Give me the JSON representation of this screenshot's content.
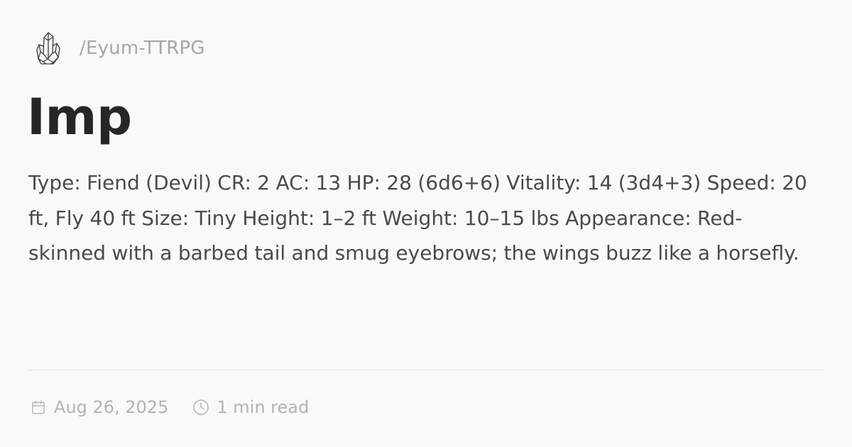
{
  "header": {
    "logo_icon": "crystal-cluster-icon",
    "site_path": "/Eyum-TTRPG"
  },
  "article": {
    "title": "Imp",
    "description": "Type: Fiend (Devil) CR: 2 AC: 13 HP: 28 (6d6+6) Vitality: 14 (3d4+3) Speed: 20 ft, Fly 40 ft Size: Tiny Height: 1–2 ft Weight: 10–15 lbs Appearance: Red-skinned with a barbed tail and smug eyebrows; the wings buzz like a horsefly."
  },
  "meta": {
    "date_icon": "calendar-icon",
    "date": "Aug 26, 2025",
    "read_time_icon": "clock-icon",
    "read_time": "1 min read"
  },
  "colors": {
    "background": "#faf9fa",
    "title": "#262626",
    "body_text": "#4a4a4a",
    "muted": "#a6a6a6"
  }
}
